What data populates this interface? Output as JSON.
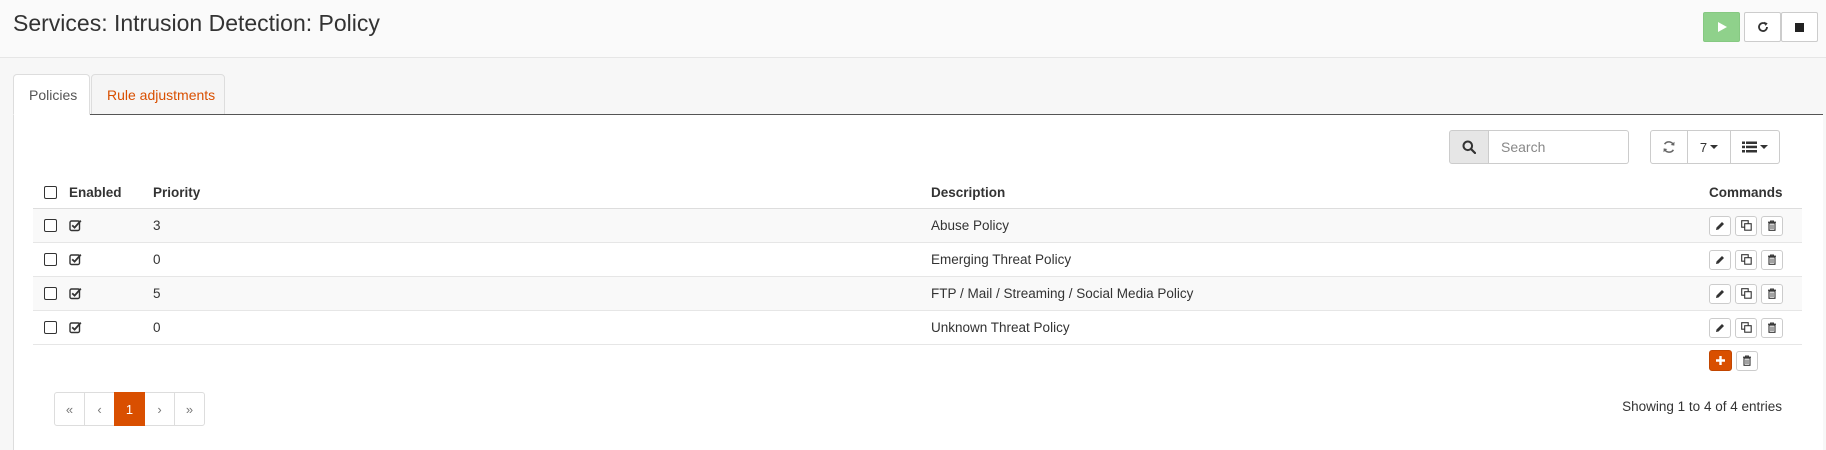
{
  "header": {
    "title": "Services: Intrusion Detection: Policy",
    "buttons": [
      {
        "name": "start",
        "icon": "play-icon",
        "color": "#8fd18b"
      },
      {
        "name": "restart",
        "icon": "refresh-icon"
      },
      {
        "name": "stop",
        "icon": "stop-icon"
      }
    ]
  },
  "tabs": [
    {
      "label": "Policies",
      "active": true
    },
    {
      "label": "Rule adjustments",
      "active": false
    }
  ],
  "toolbar": {
    "search_placeholder": "Search",
    "rows_per_page": "7",
    "icons": [
      "search-icon",
      "refresh-icon",
      "columns-list-icon"
    ]
  },
  "grid": {
    "columns": {
      "enabled": "Enabled",
      "priority": "Priority",
      "description": "Description",
      "commands": "Commands"
    },
    "rows": [
      {
        "enabled": true,
        "priority": "3",
        "description": "Abuse Policy"
      },
      {
        "enabled": true,
        "priority": "0",
        "description": "Emerging Threat Policy"
      },
      {
        "enabled": true,
        "priority": "5",
        "description": "FTP / Mail / Streaming / Social Media Policy"
      },
      {
        "enabled": true,
        "priority": "0",
        "description": "Unknown Threat Policy"
      }
    ],
    "row_commands": [
      "pencil-icon",
      "copy-icon",
      "trash-icon"
    ]
  },
  "pagination": {
    "first": "«",
    "prev": "‹",
    "current": "1",
    "next": "›",
    "last": "»",
    "info": "Showing 1 to 4 of 4 entries"
  },
  "colors": {
    "accent": "#d94f00",
    "start_button": "#8fd18b"
  }
}
